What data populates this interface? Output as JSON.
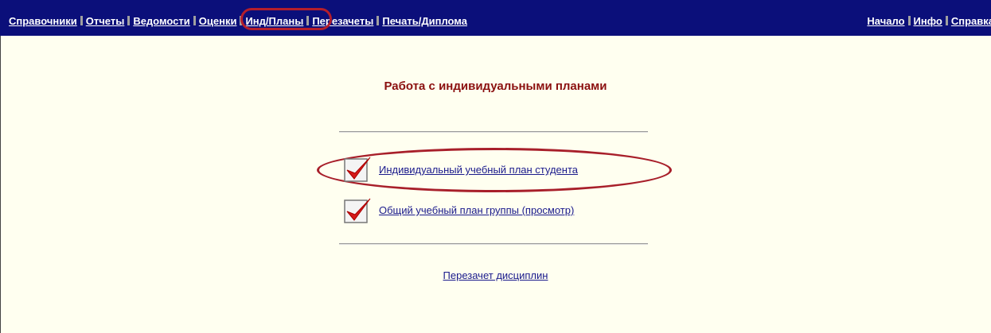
{
  "nav": {
    "left": [
      "Справочники",
      "Отчеты",
      "Ведомости",
      "Оценки",
      "Инд/Планы",
      "Перезачеты",
      "Печать/Диплома"
    ],
    "right": [
      "Начало",
      "Инфо",
      "Справка"
    ],
    "active": "Инд/Планы"
  },
  "main": {
    "title": "Работа с индивидуальными планами",
    "items": [
      {
        "label": "Индивидуальный учебный план студента",
        "icon": "red-checkmark-icon",
        "highlighted": true
      },
      {
        "label": "Общий учебный план группы (просмотр)",
        "icon": "red-checkmark-icon",
        "highlighted": false
      }
    ],
    "bottom_link": "Перезачет дисциплин"
  },
  "colors": {
    "nav_bg": "#0b0f7a",
    "page_bg": "#fffff0",
    "title": "#8b1010",
    "highlight": "#b41e2c"
  }
}
